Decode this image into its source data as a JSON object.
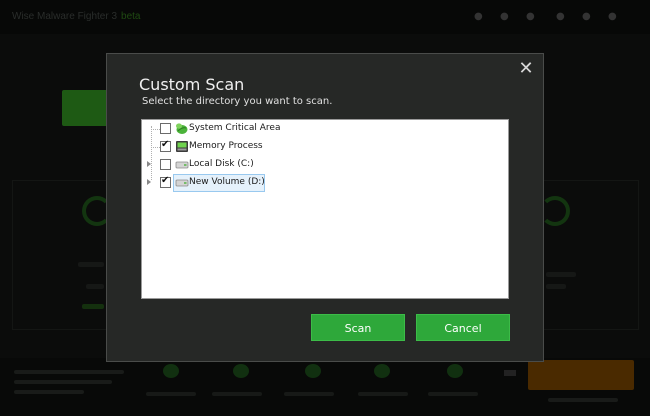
{
  "background_app": {
    "title": "Wise Malware Fighter 3",
    "title_tag": "beta"
  },
  "dialog": {
    "title": "Custom Scan",
    "subtitle": "Select the directory you want to scan.",
    "close_glyph": "✕",
    "tree": [
      {
        "label": "System Critical Area",
        "checked": false,
        "expandable": false,
        "selected": false,
        "icon": "shield-leaf-icon"
      },
      {
        "label": "Memory Process",
        "checked": true,
        "expandable": false,
        "selected": false,
        "icon": "memory-chip-icon"
      },
      {
        "label": "Local Disk (C:)",
        "checked": false,
        "expandable": true,
        "selected": false,
        "icon": "hard-drive-icon"
      },
      {
        "label": "New Volume (D:)",
        "checked": true,
        "expandable": true,
        "selected": true,
        "icon": "hard-drive-icon"
      }
    ],
    "buttons": {
      "scan_label": "Scan",
      "cancel_label": "Cancel"
    }
  },
  "colors": {
    "dialog_bg": "#262826",
    "button_green": "#2ea83a",
    "selection_bg": "#e5f1fb",
    "selection_border": "#99c9ef"
  }
}
